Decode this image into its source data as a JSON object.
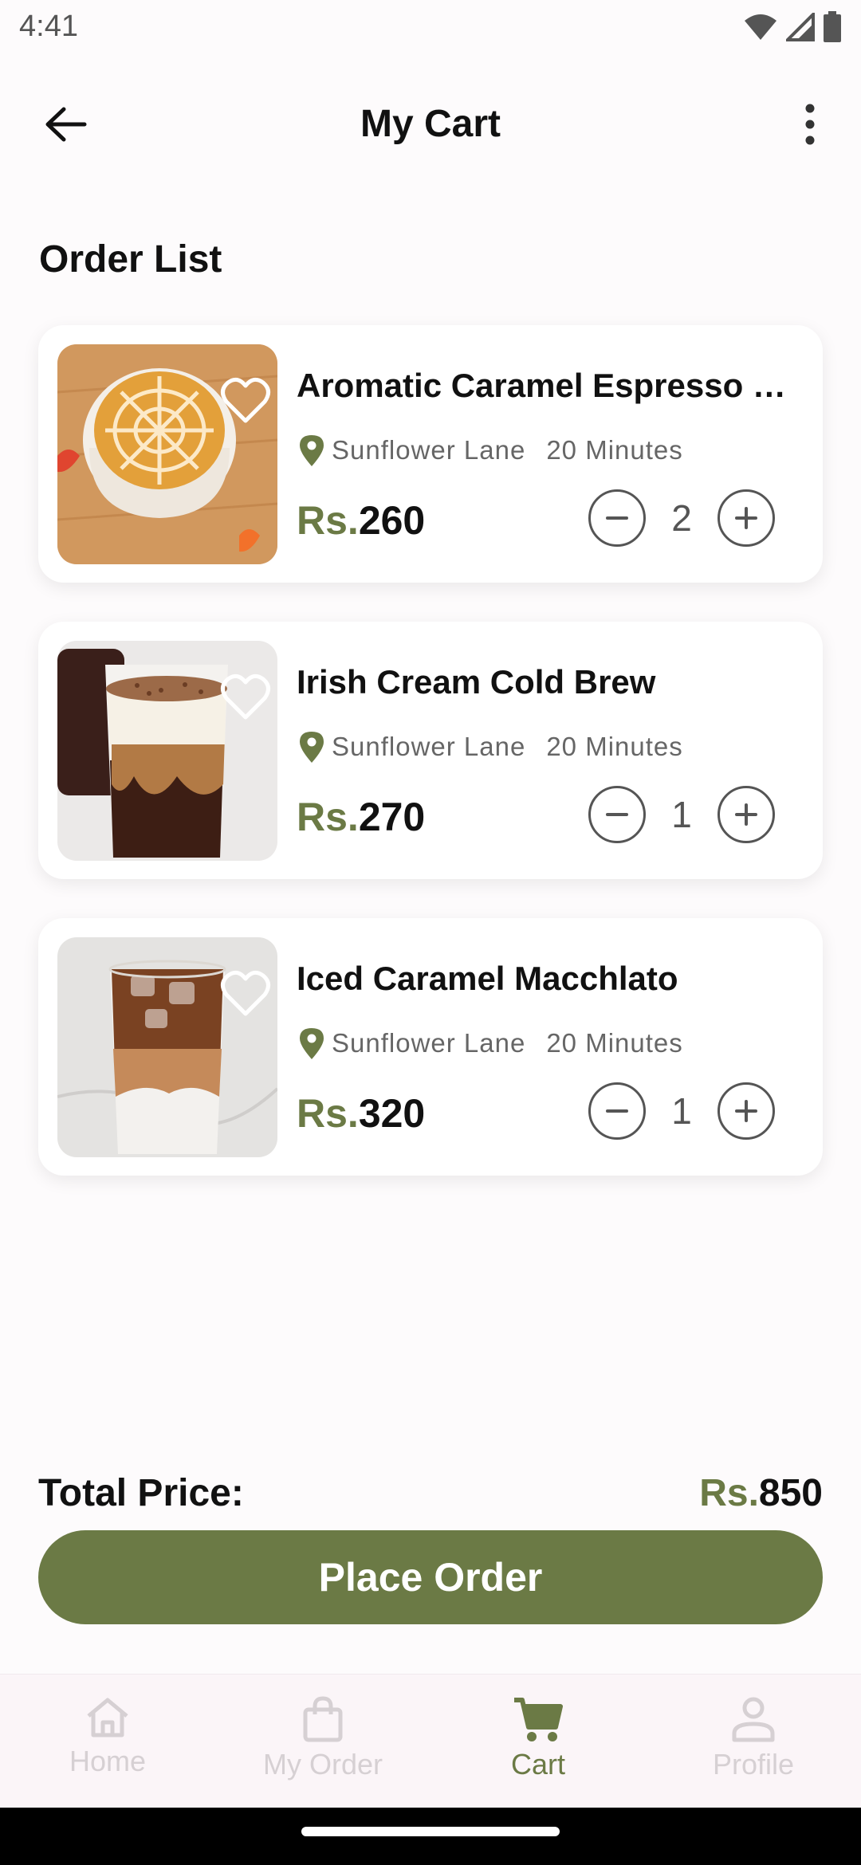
{
  "status_bar": {
    "time": "4:41"
  },
  "app_bar": {
    "title": "My Cart"
  },
  "section_title": "Order List",
  "items": [
    {
      "name": "Aromatic Caramel Espresso …",
      "location": "Sunflower Lane",
      "duration": "20 Minutes",
      "currency": "Rs.",
      "price": "260",
      "quantity": "2",
      "image": "caramel-latte-art"
    },
    {
      "name": "Irish Cream Cold Brew",
      "location": "Sunflower Lane",
      "duration": "20 Minutes",
      "currency": "Rs.",
      "price": "270",
      "quantity": "1",
      "image": "irish-cream-cold-brew"
    },
    {
      "name": "Iced Caramel Macchlato",
      "location": "Sunflower Lane",
      "duration": "20 Minutes",
      "currency": "Rs.",
      "price": "320",
      "quantity": "1",
      "image": "iced-caramel-macchiato"
    }
  ],
  "total": {
    "label": "Total Price:",
    "currency": "Rs.",
    "amount": "850"
  },
  "place_order_label": "Place Order",
  "bottom_nav": [
    {
      "label": "Home",
      "icon": "home-icon",
      "active": false
    },
    {
      "label": "My Order",
      "icon": "shopping-bag-icon",
      "active": false
    },
    {
      "label": "Cart",
      "icon": "cart-icon",
      "active": true
    },
    {
      "label": "Profile",
      "icon": "person-icon",
      "active": false
    }
  ],
  "colors": {
    "accent": "#6b7a45",
    "text": "#111111",
    "muted": "#666666",
    "inactive_nav": "#d6d0d3"
  }
}
